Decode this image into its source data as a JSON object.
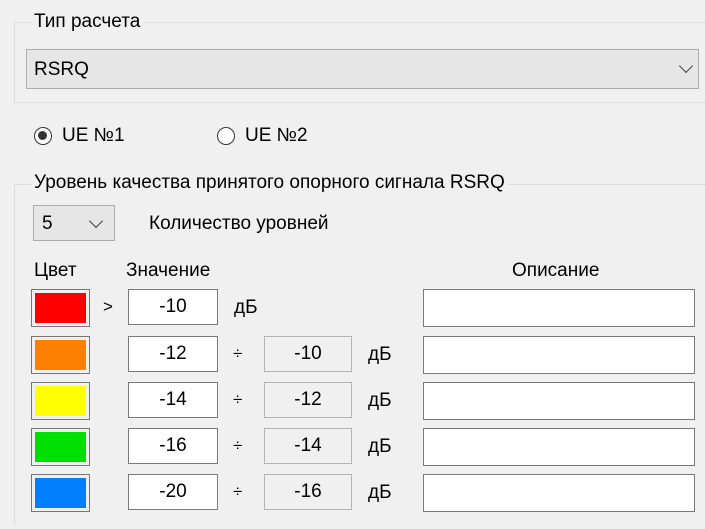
{
  "calc_type": {
    "label": "Тип расчета",
    "value": "RSRQ"
  },
  "ue": {
    "options": [
      {
        "label": "UE №1",
        "selected": true
      },
      {
        "label": "UE №2",
        "selected": false
      }
    ]
  },
  "quality_group": {
    "title": "Уровень качества принятого опорного сигнала RSRQ",
    "levels_value": "5",
    "levels_label": "Количество уровней",
    "col_color": "Цвет",
    "col_value": "Значение",
    "col_desc": "Описание",
    "gt_symbol": ">",
    "range_symbol": "÷",
    "unit": "дБ",
    "rows": [
      {
        "color": "#ff0000",
        "from": "-10",
        "to": null,
        "desc": ""
      },
      {
        "color": "#ff7f00",
        "from": "-12",
        "to": "-10",
        "desc": ""
      },
      {
        "color": "#ffff00",
        "from": "-14",
        "to": "-12",
        "desc": ""
      },
      {
        "color": "#00e000",
        "from": "-16",
        "to": "-14",
        "desc": ""
      },
      {
        "color": "#0080ff",
        "from": "-20",
        "to": "-16",
        "desc": ""
      }
    ]
  }
}
